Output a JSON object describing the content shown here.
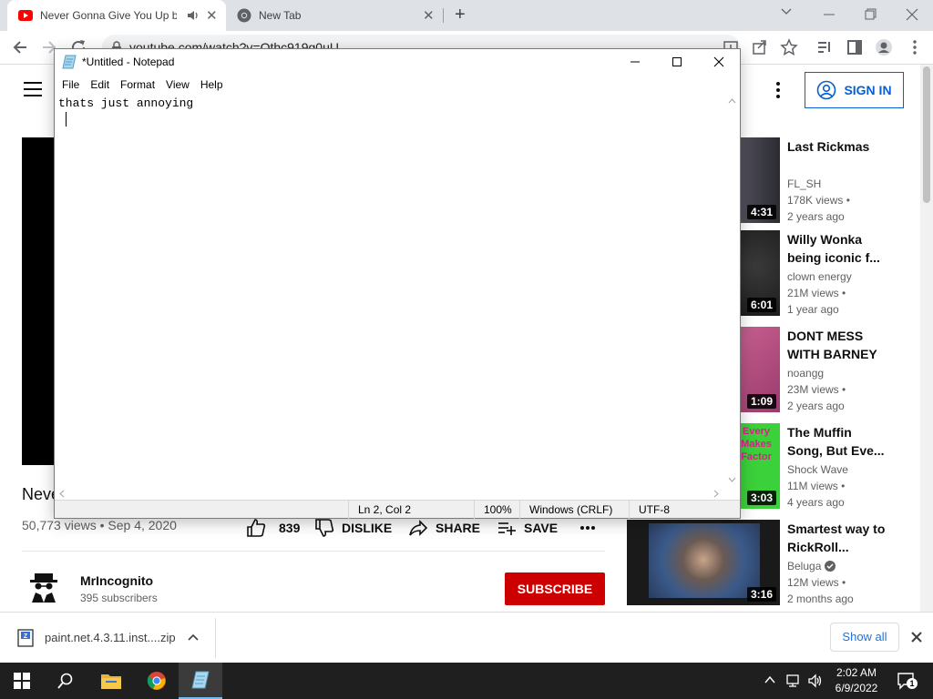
{
  "browser": {
    "tabs": [
      {
        "title": "Never Gonna Give You Up b",
        "active": true
      },
      {
        "title": "New Tab",
        "active": false
      }
    ],
    "url": "youtube.com/watch?v=Qthc919g0uU"
  },
  "youtube": {
    "signin_label": "SIGN IN",
    "video_title": "Neve",
    "video_meta": "50,773 views • Sep 4, 2020",
    "actions": {
      "like_count": "839",
      "dislike_label": "DISLIKE",
      "share_label": "SHARE",
      "save_label": "SAVE"
    },
    "channel": {
      "name": "MrIncognito",
      "subscribers": "395 subscribers"
    },
    "subscribe_label": "SUBSCRIBE",
    "recommendations": [
      {
        "title": "Last Rickmas",
        "channel": "FL_SH",
        "views": "178K views •",
        "age": "2 years ago",
        "duration": "4:31",
        "verified": false
      },
      {
        "title": "Willy Wonka being iconic f...",
        "channel": "clown energy",
        "views": "21M views •",
        "age": "1 year ago",
        "duration": "6:01",
        "verified": false
      },
      {
        "title": "DONT MESS WITH BARNEY",
        "channel": "noangg",
        "views": "23M views •",
        "age": "2 years ago",
        "duration": "1:09",
        "verified": false
      },
      {
        "title": "The Muffin Song, But Eve...",
        "channel": "Shock Wave",
        "views": "11M views •",
        "age": "4 years ago",
        "duration": "3:03",
        "verified": false,
        "thumb_text": "Every Makes Factor"
      },
      {
        "title": "Smartest way to RickRoll...",
        "channel": "Beluga",
        "views": "12M views •",
        "age": "2 months ago",
        "duration": "3:16",
        "verified": true
      }
    ]
  },
  "download_bar": {
    "file_name": "paint.net.4.3.11.inst....zip",
    "show_all_label": "Show all"
  },
  "notepad": {
    "window_title": "*Untitled - Notepad",
    "menu": [
      "File",
      "Edit",
      "Format",
      "View",
      "Help"
    ],
    "text_line1": "thats just annoying",
    "status": {
      "position": "Ln 2, Col 2",
      "zoom": "100%",
      "line_ending": "Windows (CRLF)",
      "encoding": "UTF-8"
    }
  },
  "taskbar": {
    "time": "2:02 AM",
    "date": "6/9/2022",
    "notification_count": "1"
  }
}
